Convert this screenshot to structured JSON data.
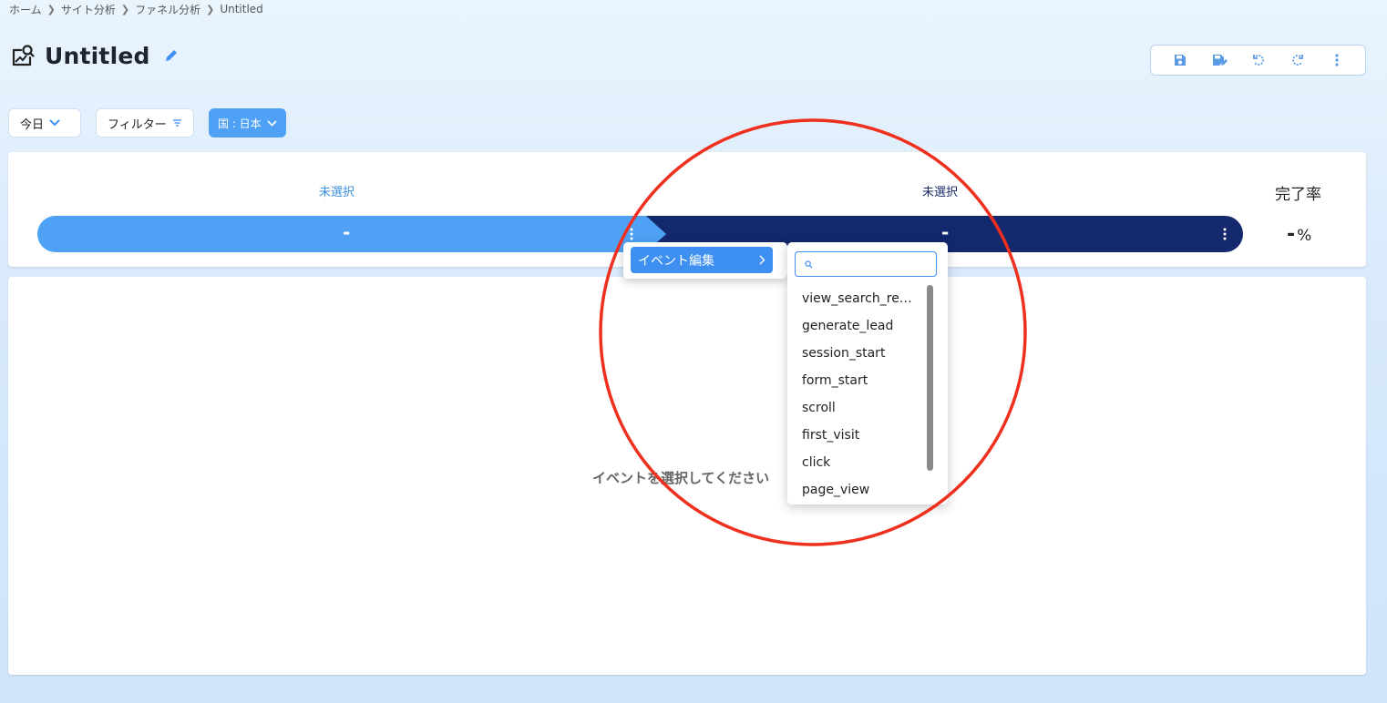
{
  "breadcrumb": [
    "ホーム",
    "サイト分析",
    "ファネル分析",
    "Untitled"
  ],
  "title": "Untitled",
  "toolbar": {
    "icons": [
      "save-icon",
      "save-as-icon",
      "undo-icon",
      "redo-icon",
      "more-vert-icon"
    ]
  },
  "filters": {
    "date_label": "今日",
    "filter_label": "フィルター",
    "country_label": "国 : 日本"
  },
  "funnel": {
    "step1_label": "未選択",
    "step2_label": "未選択",
    "step1_value": "-",
    "step2_value": "-",
    "rate_label": "完了率",
    "rate_value": "-",
    "rate_unit": "%"
  },
  "main": {
    "empty_message": "イベントを選択してください"
  },
  "context_menu": {
    "item_label": "イベント編集"
  },
  "submenu": {
    "search_placeholder": "",
    "events": [
      "view_search_re…",
      "generate_lead",
      "session_start",
      "form_start",
      "scroll",
      "first_visit",
      "click",
      "page_view"
    ]
  },
  "colors": {
    "accent": "#4ea1f5",
    "dark_bar": "#13286d",
    "menu_highlight": "#3d8ff2",
    "annotation": "#f0301e"
  }
}
